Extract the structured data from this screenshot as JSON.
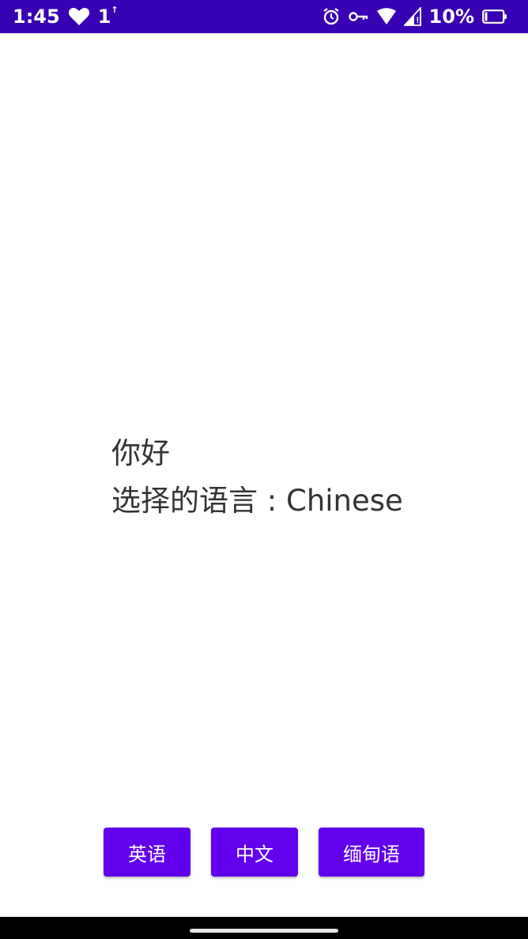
{
  "status_bar": {
    "time": "1:45",
    "data_indicator": "1",
    "data_indicator_sup": "↑",
    "battery_percent": "10%",
    "background_color": "#3700b3",
    "left_icons": [
      "heart-icon",
      "data-activity-icon"
    ],
    "right_icons": [
      "alarm-icon",
      "vpn-key-icon",
      "wifi-icon",
      "cellular-signal-icon",
      "battery-icon"
    ]
  },
  "main": {
    "greeting": "你好",
    "selected_language_label": "选择的语言 : Chinese"
  },
  "buttons": {
    "english_label": "英语",
    "chinese_label": "中文",
    "burmese_label": "缅甸语",
    "color": "#6200ee"
  },
  "nav_bar": {
    "icon": "home-gesture-handle"
  }
}
